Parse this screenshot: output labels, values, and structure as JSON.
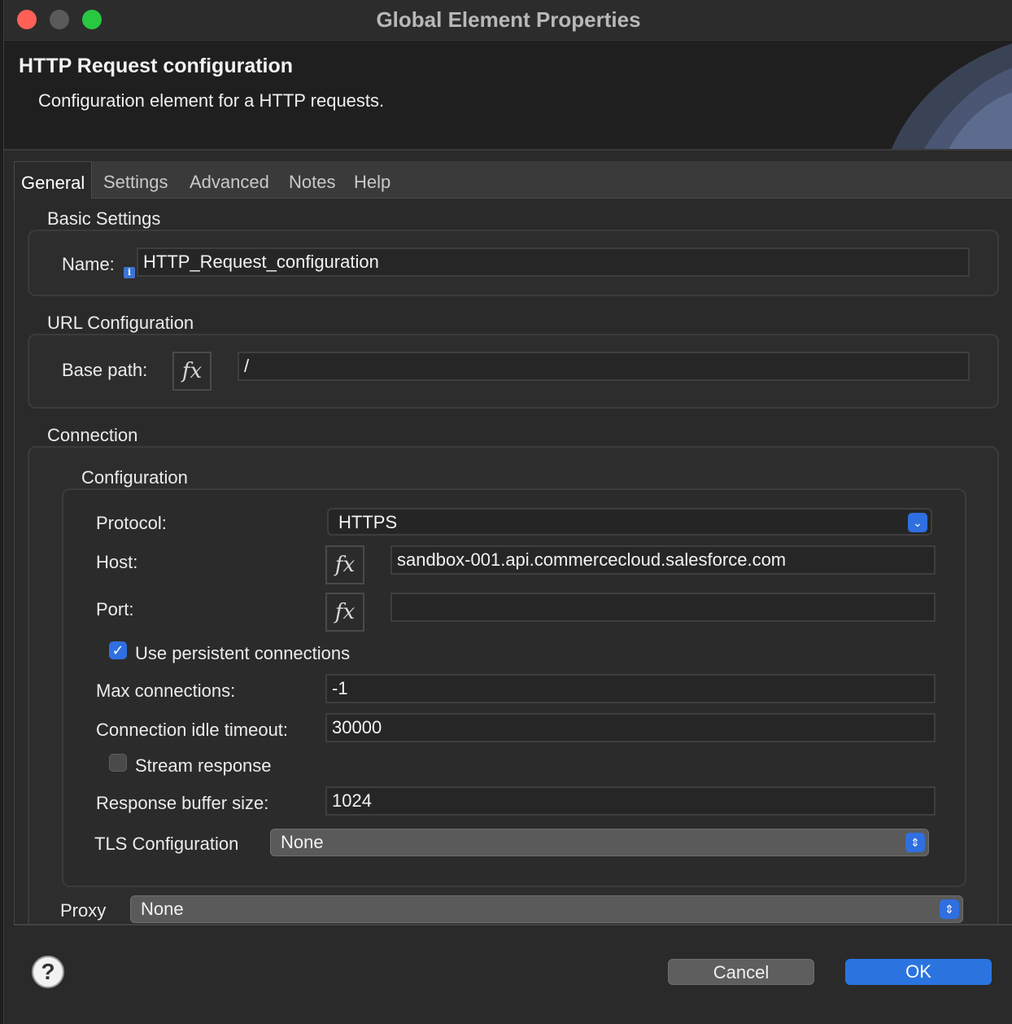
{
  "window": {
    "title": "Global Element Properties"
  },
  "header": {
    "title": "HTTP Request configuration",
    "subtitle": "Configuration element for a HTTP requests."
  },
  "tabs": [
    {
      "label": "General",
      "active": true
    },
    {
      "label": "Settings"
    },
    {
      "label": "Advanced"
    },
    {
      "label": "Notes"
    },
    {
      "label": "Help"
    }
  ],
  "basic_settings": {
    "section_label": "Basic Settings",
    "name_label": "Name:",
    "name_value": "HTTP_Request_configuration",
    "info_glyph": "i"
  },
  "url_configuration": {
    "section_label": "URL Configuration",
    "base_path_label": "Base path:",
    "fx_glyph": "fx",
    "base_path_value": "/"
  },
  "connection": {
    "section_label": "Connection",
    "configuration_label": "Configuration",
    "protocol_label": "Protocol:",
    "protocol_value": "HTTPS",
    "host_label": "Host:",
    "host_value": "sandbox-001.api.commercecloud.salesforce.com",
    "port_label": "Port:",
    "port_value": "",
    "persistent_label": "Use persistent connections",
    "persistent_checked": true,
    "max_connections_label": "Max connections:",
    "max_connections_value": "-1",
    "idle_timeout_label": "Connection idle timeout:",
    "idle_timeout_value": "30000",
    "stream_response_label": "Stream response",
    "stream_response_checked": false,
    "buffer_size_label": "Response buffer size:",
    "buffer_size_value": "1024",
    "tls_label": "TLS Configuration",
    "tls_value": "None",
    "proxy_label": "Proxy",
    "proxy_value": "None"
  },
  "footer": {
    "help_glyph": "?",
    "cancel_label": "Cancel",
    "ok_label": "OK"
  },
  "icons": {
    "dropdown": "chevron-down-icon",
    "popup": "up-down-arrows-icon",
    "check": "checkmark-icon"
  },
  "colors": {
    "accent": "#2f6fe0",
    "close": "#ff5f57",
    "maximize": "#28c840"
  }
}
